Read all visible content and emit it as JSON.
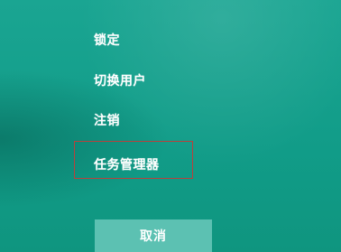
{
  "menu": {
    "items": [
      {
        "label": "锁定"
      },
      {
        "label": "切换用户"
      },
      {
        "label": "注销"
      },
      {
        "label": "任务管理器"
      }
    ],
    "highlighted_item": "任务管理器",
    "highlight_color": "#b8413c"
  },
  "cancel": {
    "label": "取消"
  },
  "colors": {
    "background": "#14a08c",
    "cancel_button": "#5cc1b2",
    "text": "#ffffff"
  }
}
